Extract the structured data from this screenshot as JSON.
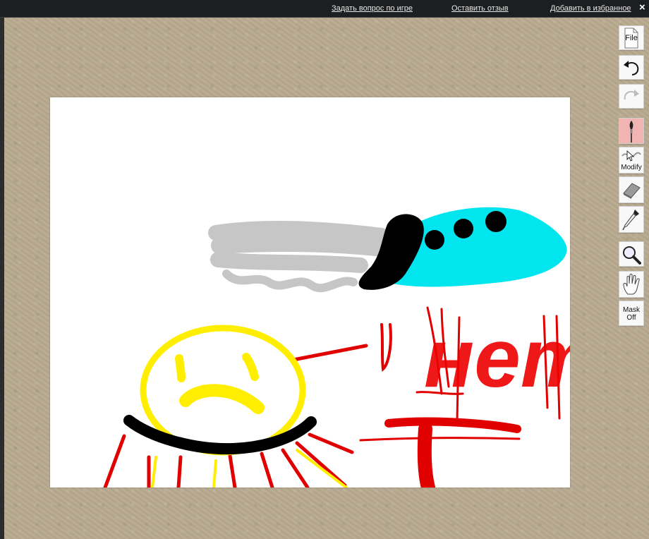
{
  "topbar": {
    "links": [
      "Задать вопрос по игре",
      "Оставить отзыв",
      "Добавить в избранное"
    ],
    "close_glyph": "×"
  },
  "toolbar": {
    "file_label": "File",
    "undo_icon": "undo-icon",
    "redo_icon": "redo-icon",
    "brush_icon": "brush-icon",
    "modify_label": "Modify",
    "eraser_icon": "eraser-icon",
    "eyedropper_icon": "eyedropper-icon",
    "zoom_icon": "magnifier-icon",
    "hand_icon": "hand-icon",
    "mask_label_line1": "Mask",
    "mask_label_line2": "Off",
    "active_tool": "brush",
    "active_color": "#f2b3b3"
  },
  "canvas_drawing": {
    "stroke_colors": [
      "#c8c8c8",
      "#00e5ee",
      "#000000",
      "#ffee00",
      "#ee0000"
    ],
    "painted_text": "нет"
  }
}
